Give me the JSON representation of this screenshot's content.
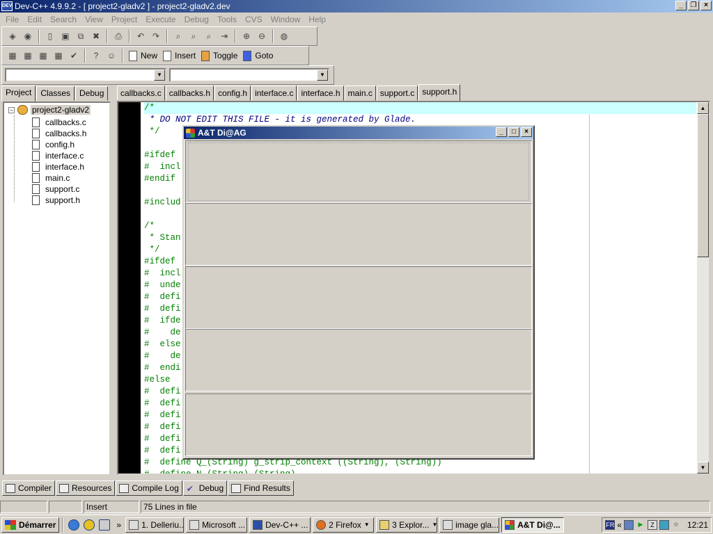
{
  "window": {
    "title": "Dev-C++ 4.9.9.2  - [ project2-gladv2 ] - project2-gladv2.dev",
    "app_icon_text": "DEV"
  },
  "menu": [
    "File",
    "Edit",
    "Search",
    "View",
    "Project",
    "Execute",
    "Debug",
    "Tools",
    "CVS",
    "Window",
    "Help"
  ],
  "toolbar2": {
    "new_label": "New",
    "insert_label": "Insert",
    "toggle_label": "Toggle",
    "goto_label": "Goto"
  },
  "left_tabs": [
    "Project",
    "Classes",
    "Debug"
  ],
  "editor_tabs": [
    "callbacks.c",
    "callbacks.h",
    "config.h",
    "interface.c",
    "interface.h",
    "main.c",
    "support.c",
    "support.h"
  ],
  "project": {
    "root": "project2-gladv2",
    "files": [
      "callbacks.c",
      "callbacks.h",
      "config.h",
      "interface.c",
      "interface.h",
      "main.c",
      "support.c",
      "support.h"
    ]
  },
  "code_lines": [
    "/*",
    " * DO NOT EDIT THIS FILE - it is generated by Glade.",
    " */",
    "",
    "#ifdef",
    "#  incl",
    "#endif",
    "",
    "#includ",
    "",
    "/*",
    " * Stan",
    " */",
    "#ifdef",
    "#  incl",
    "#  unde",
    "#  defi",
    "#  defi",
    "#  ifde",
    "#    de",
    "#  else",
    "#    de",
    "#  endi",
    "#else",
    "#  defi",
    "#  defi",
    "#  defi",
    "#  defi",
    "#  defi",
    "#  defi",
    "#  define Q_(String) g_strip_context ((String), (String))",
    "#  define N_(String) (String)"
  ],
  "dialog": {
    "title": "A&T Di@AG"
  },
  "bottom_tabs": [
    "Compiler",
    "Resources",
    "Compile Log",
    "Debug",
    "Find Results"
  ],
  "status": {
    "cell1": "",
    "cell2": "",
    "mode": "Insert",
    "info": "75 Lines in file"
  },
  "taskbar": {
    "start_label": "Démarrer",
    "tasks": [
      "1. Delleriu...",
      "Microsoft ...",
      "Dev-C++ ...",
      "2 Firefox",
      "3 Explor...",
      "image gla...",
      "A&T Di@..."
    ],
    "lang": "FR",
    "clock": "12:21"
  }
}
